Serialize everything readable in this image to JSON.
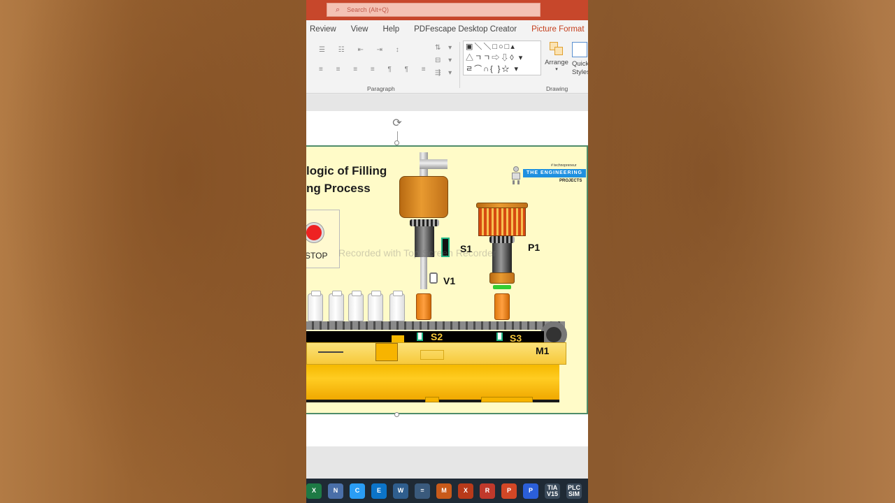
{
  "search": {
    "placeholder": "Search (Alt+Q)"
  },
  "menu": {
    "tabs": [
      "Review",
      "View",
      "Help",
      "PDFescape Desktop Creator",
      "Picture Format"
    ]
  },
  "ribbon": {
    "groups": {
      "paragraph": "Paragraph",
      "drawing": "Drawing"
    },
    "arrange": "Arrange",
    "quick_styles": "Quick Styles"
  },
  "diagram": {
    "title_line1": "logic of Filling",
    "title_line2": "ng Process",
    "logo": {
      "tagline": "# technopreneur",
      "brand": "THE ENGINEERING",
      "sub": "PROJECTS"
    },
    "stop_label": "STOP",
    "labels": {
      "s1": "S1",
      "p1": "P1",
      "v1": "V1",
      "s2": "S2",
      "s3": "S3",
      "m1": "M1"
    },
    "watermark": "Recorded with Top Screen Recorder"
  },
  "taskbar": {
    "apps": [
      {
        "name": "excel",
        "label": "X",
        "color": "#1d7a45"
      },
      {
        "name": "notepad",
        "label": "N",
        "color": "#4a6fa8"
      },
      {
        "name": "chrome",
        "label": "C",
        "color": "#2a9df4"
      },
      {
        "name": "edge",
        "label": "E",
        "color": "#0c74c8"
      },
      {
        "name": "network",
        "label": "W",
        "color": "#2f5e8e"
      },
      {
        "name": "calculator",
        "label": "=",
        "color": "#3a5a7c"
      },
      {
        "name": "matlab",
        "label": "M",
        "color": "#c85a1a"
      },
      {
        "name": "xlaunch",
        "label": "X",
        "color": "#b83a1a"
      },
      {
        "name": "recorder",
        "label": "R",
        "color": "#c0392b"
      },
      {
        "name": "powerpoint",
        "label": "P",
        "color": "#d24726"
      },
      {
        "name": "pdf",
        "label": "P",
        "color": "#2b5fd9"
      },
      {
        "name": "tia",
        "label": "TIA V15",
        "color": "#3a4a5a"
      },
      {
        "name": "plcsim",
        "label": "PLC SIM",
        "color": "#3a4a5a"
      }
    ]
  }
}
